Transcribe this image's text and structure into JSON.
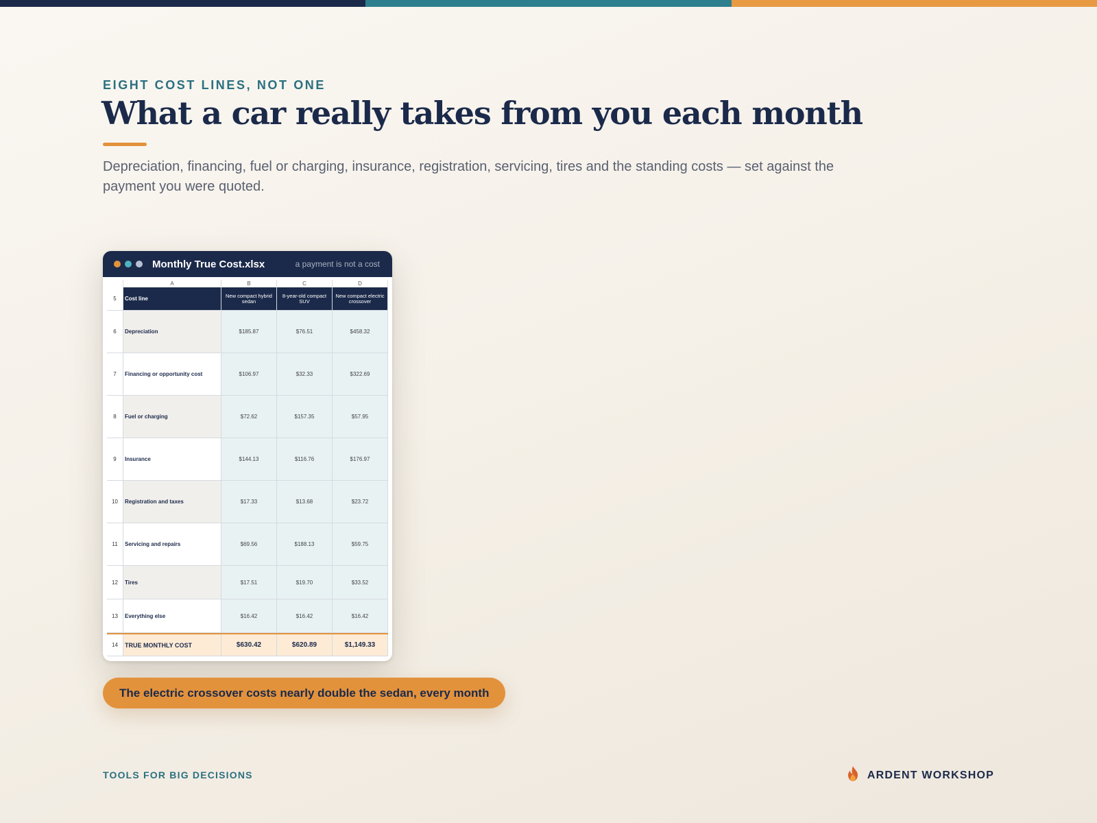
{
  "colors": {
    "navy": "#1b2a4a",
    "teal": "#2b7080",
    "orange": "#e3923c"
  },
  "eyebrow": "EIGHT COST LINES, NOT ONE",
  "headline": "What a car really takes from you each month",
  "lede": "Depreciation, financing, fuel or charging, insurance, registration, servicing, tires and the standing costs — set against the payment you were quoted.",
  "window": {
    "title": "Monthly True Cost.xlsx",
    "subtitle": "a payment is not a cost",
    "column_letters": [
      "A",
      "B",
      "C",
      "D"
    ],
    "header": {
      "row_number": "5",
      "label": "Cost line",
      "columns": [
        "New compact hybrid sedan",
        "8-year-old compact SUV",
        "New compact electric crossover"
      ]
    },
    "rows": [
      {
        "row_number": "6",
        "label": "Depreciation",
        "values": [
          "$185.87",
          "$76.51",
          "$458.32"
        ]
      },
      {
        "row_number": "7",
        "label": "Financing or opportunity cost",
        "values": [
          "$106.97",
          "$32.33",
          "$322.69"
        ]
      },
      {
        "row_number": "8",
        "label": "Fuel or charging",
        "values": [
          "$72.62",
          "$157.35",
          "$57.95"
        ]
      },
      {
        "row_number": "9",
        "label": "Insurance",
        "values": [
          "$144.13",
          "$116.76",
          "$176.97"
        ]
      },
      {
        "row_number": "10",
        "label": "Registration and taxes",
        "values": [
          "$17.33",
          "$13.68",
          "$23.72"
        ]
      },
      {
        "row_number": "11",
        "label": "Servicing and repairs",
        "values": [
          "$69.56",
          "$188.13",
          "$59.75"
        ]
      },
      {
        "row_number": "12",
        "label": "Tires",
        "values": [
          "$17.51",
          "$19.70",
          "$33.52"
        ]
      },
      {
        "row_number": "13",
        "label": "Everything else",
        "values": [
          "$16.42",
          "$16.42",
          "$16.42"
        ]
      }
    ],
    "total": {
      "row_number": "14",
      "label": "TRUE MONTHLY COST",
      "values": [
        "$630.42",
        "$620.89",
        "$1,149.33"
      ]
    }
  },
  "callout": "The electric crossover costs nearly double the sedan, every month",
  "footer": {
    "left": "TOOLS FOR BIG DECISIONS",
    "brand": "ARDENT WORKSHOP",
    "brand_icon": "flame-logo-icon"
  }
}
